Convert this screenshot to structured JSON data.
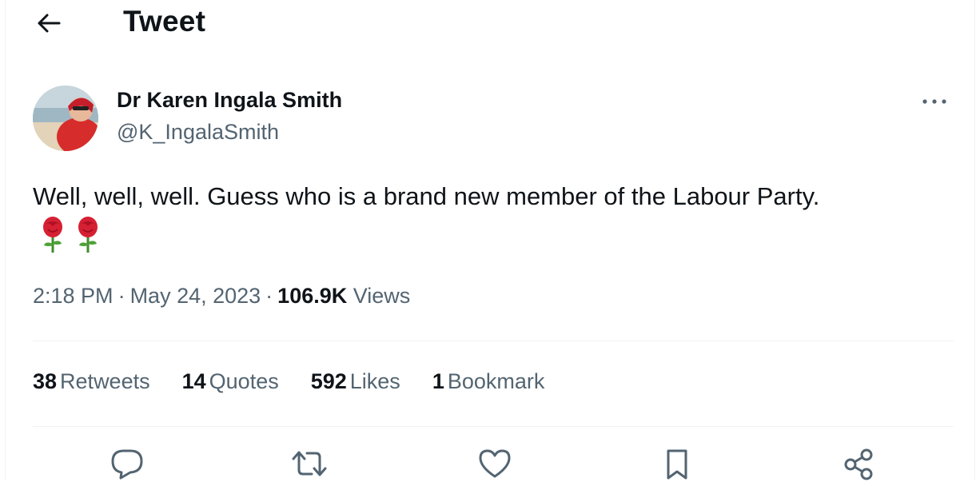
{
  "header": {
    "title": "Tweet",
    "back_icon": "arrow-left-icon"
  },
  "tweet": {
    "author": {
      "name": "Dr Karen Ingala Smith",
      "handle": "@K_IngalaSmith"
    },
    "more_icon": "more-horizontal-icon",
    "text": "Well, well, well. Guess who is a brand new member of the Labour Party.",
    "emojis": [
      "rose-icon",
      "rose-icon"
    ],
    "time": "2:18 PM",
    "separator": "·",
    "date": "May 24, 2023",
    "views_count": "106.9K",
    "views_label": "Views"
  },
  "stats": {
    "retweets": {
      "count": "38",
      "label": "Retweets"
    },
    "quotes": {
      "count": "14",
      "label": "Quotes"
    },
    "likes": {
      "count": "592",
      "label": "Likes"
    },
    "bookmarks": {
      "count": "1",
      "label": "Bookmark"
    }
  },
  "actions": [
    "reply-icon",
    "retweet-icon",
    "like-icon",
    "bookmark-icon",
    "share-icon"
  ],
  "colors": {
    "text": "#0f1419",
    "secondary": "#536471",
    "divider": "#eff3f4",
    "rose": "#d62033"
  }
}
